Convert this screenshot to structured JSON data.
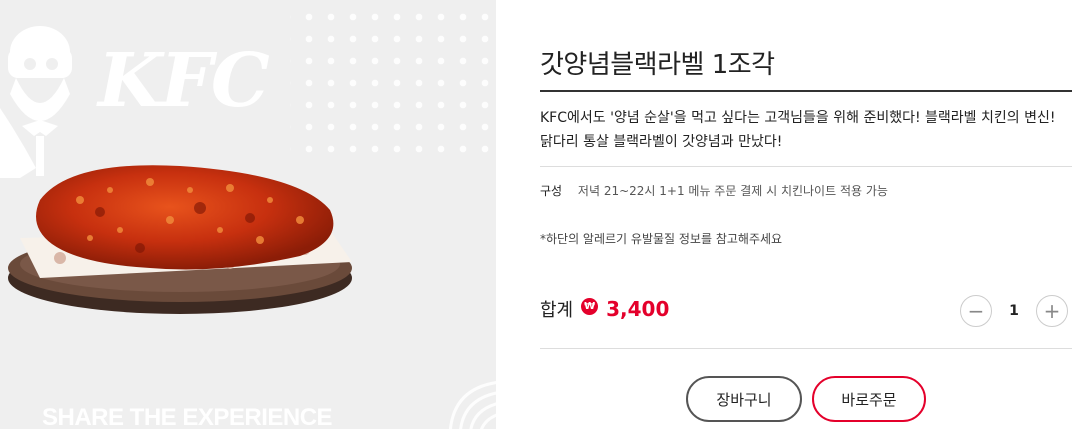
{
  "image_panel": {
    "logo_text": "KFC",
    "slogan": "SHARE THE EXPERIENCE",
    "alt": "갓양념블랙라벨 1조각"
  },
  "product": {
    "title": "갓양념블랙라벨 1조각",
    "description": "KFC에서도 '양념 순살'을 먹고 싶다는 고객님들을 위해 준비했다! 블랙라벨 치킨의 변신! 닭다리 통살 블랙라벨이 갓양념과 만났다!",
    "composition_label": "구성",
    "composition_value": "저녁 21~22시 1+1 메뉴 주문 결제 시 치킨나이트 적용 가능",
    "allergy_note": "*하단의 알레르기 유발물질 정보를 참고해주세요"
  },
  "order": {
    "total_label": "합계",
    "currency_symbol": "₩",
    "price": "3,400",
    "quantity": "1",
    "decrease_symbol": "−",
    "increase_symbol": "+"
  },
  "buttons": {
    "cart_label": "장바구니",
    "order_label": "바로주문"
  },
  "colors": {
    "brand_red": "#e4002b",
    "panel_bg": "#efefef"
  }
}
